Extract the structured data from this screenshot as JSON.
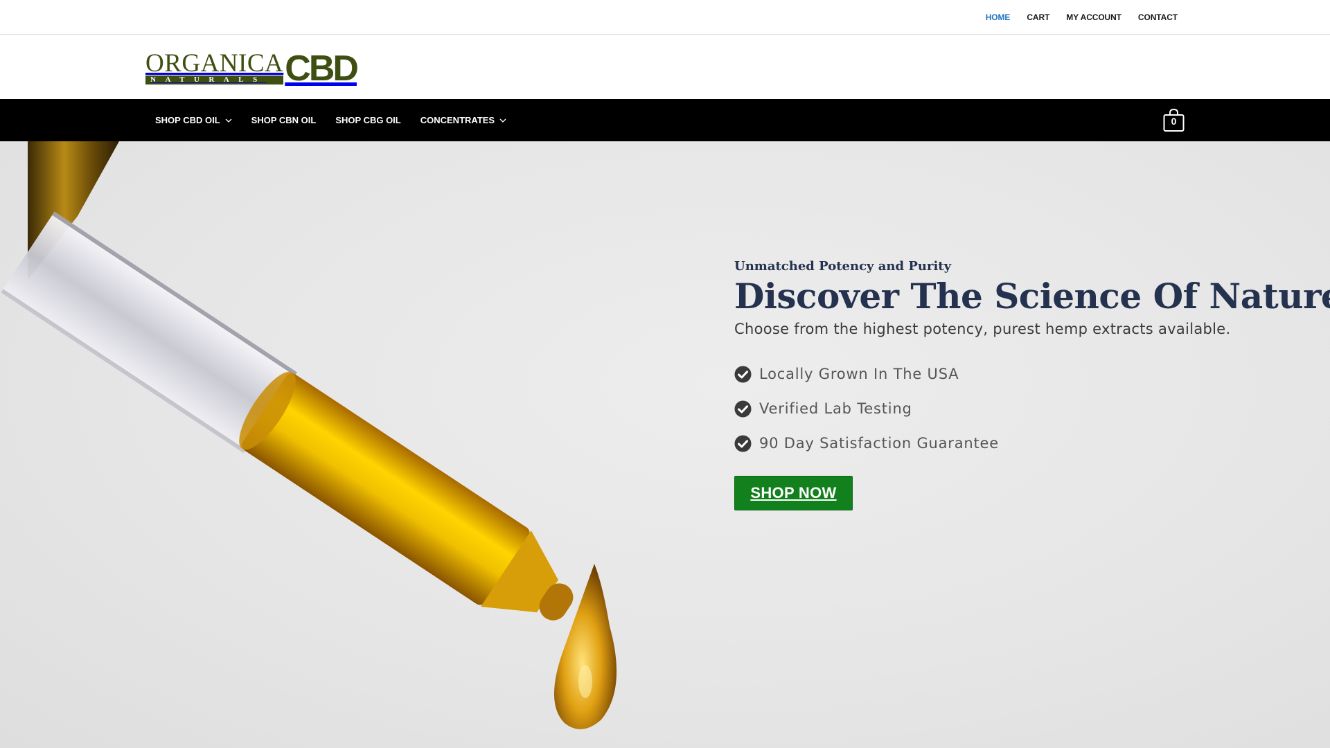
{
  "top_nav": {
    "items": [
      {
        "label": "HOME",
        "active": true
      },
      {
        "label": "CART",
        "active": false
      },
      {
        "label": "MY ACCOUNT",
        "active": false
      },
      {
        "label": "CONTACT",
        "active": false
      }
    ]
  },
  "logo": {
    "line1": "ORGANICA",
    "line2": "NATURALS",
    "mark": "CBD"
  },
  "main_nav": {
    "items": [
      {
        "label": "SHOP CBD OIL",
        "has_dropdown": true
      },
      {
        "label": "SHOP CBN OIL",
        "has_dropdown": false
      },
      {
        "label": "SHOP CBG OIL",
        "has_dropdown": false
      },
      {
        "label": "CONCENTRATES",
        "has_dropdown": true
      }
    ],
    "cart_count": "0",
    "cart_icon": "shopping-bag-icon"
  },
  "hero": {
    "eyebrow": "Unmatched Potency and Purity",
    "headline": "Discover The Science Of Nature",
    "subline": "Choose from the highest potency, purest hemp extracts available.",
    "features": [
      "Locally Grown In The USA",
      "Verified Lab Testing",
      "90 Day Satisfaction Guarantee"
    ],
    "feature_icon": "check-circle-icon",
    "cta_label": "SHOP NOW"
  },
  "colors": {
    "brand_green": "#3f4f12",
    "cta_green": "#12801c",
    "heading_navy": "#24324f",
    "active_link": "#1e73be",
    "nav_bg": "#000000"
  }
}
